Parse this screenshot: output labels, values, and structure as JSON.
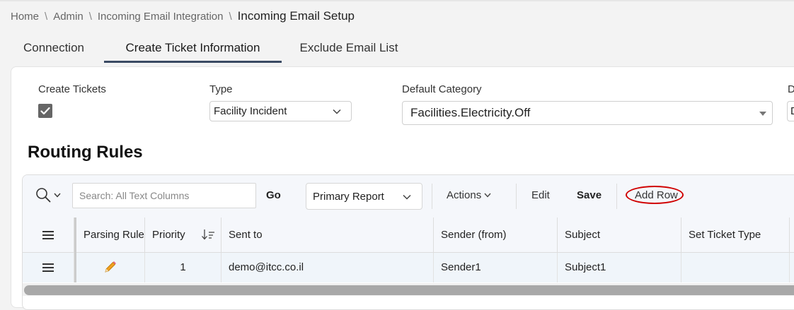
{
  "breadcrumb": {
    "items": [
      "Home",
      "Admin",
      "Incoming Email Integration"
    ],
    "separator": "\\",
    "current": "Incoming Email Setup"
  },
  "tabs": [
    {
      "label": "Connection",
      "active": false
    },
    {
      "label": "Create Ticket Information",
      "active": true
    },
    {
      "label": "Exclude Email List",
      "active": false
    }
  ],
  "form": {
    "create_tickets_label": "Create Tickets",
    "create_tickets_checked": true,
    "type_label": "Type",
    "type_value": "Facility Incident",
    "default_category_label": "Default Category",
    "default_category_value": "Facilities.Electricity.Off",
    "cut_label": "D",
    "cut_value": "D"
  },
  "routing": {
    "title": "Routing Rules",
    "toolbar": {
      "search_placeholder": "Search: All Text Columns",
      "go_label": "Go",
      "report_value": "Primary Report",
      "actions_label": "Actions",
      "edit_label": "Edit",
      "save_label": "Save",
      "add_row_label": "Add Row",
      "add_row_highlight_color": "#d00000"
    },
    "columns": [
      "Parsing Rules",
      "Priority",
      "Sent to",
      "Sender (from)",
      "Subject",
      "Set Ticket Type"
    ],
    "rows": [
      {
        "priority": "1",
        "sent_to": "demo@itcc.co.il",
        "sender": "Sender1",
        "subject": "Subject1",
        "set_ticket_type": ""
      }
    ]
  },
  "colors": {
    "active_tab_underline": "#3a4a63",
    "row_highlight": "#f0f5fa",
    "pencil": "#f0a020"
  }
}
